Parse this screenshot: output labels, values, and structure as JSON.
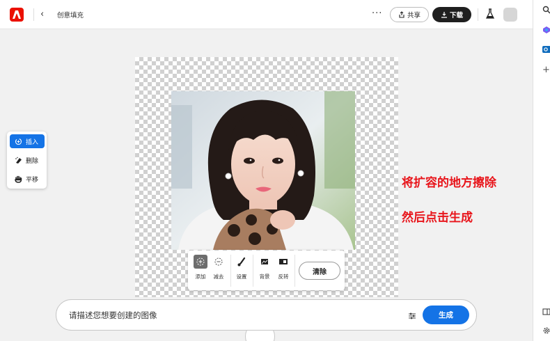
{
  "header": {
    "title": "创意填充",
    "more": "···",
    "share_label": "共享",
    "download_label": "下载"
  },
  "tools": [
    {
      "label": "插入",
      "icon": "insert-icon"
    },
    {
      "label": "删除",
      "icon": "eraser-icon"
    },
    {
      "label": "平移",
      "icon": "hand-icon"
    }
  ],
  "editbar": {
    "add_label": "添加",
    "subtract_label": "减去",
    "settings_label": "设置",
    "background_label": "背景",
    "invert_label": "反转",
    "clear_label": "清除"
  },
  "annotations": {
    "line1": "将扩容的地方擦除",
    "line2": "然后点击生成"
  },
  "prompt": {
    "placeholder": "请描述您想要创建的图像",
    "generate_label": "生成"
  },
  "colors": {
    "accent": "#1473e6",
    "brand": "#eb1000",
    "annotation": "#e8151b"
  }
}
